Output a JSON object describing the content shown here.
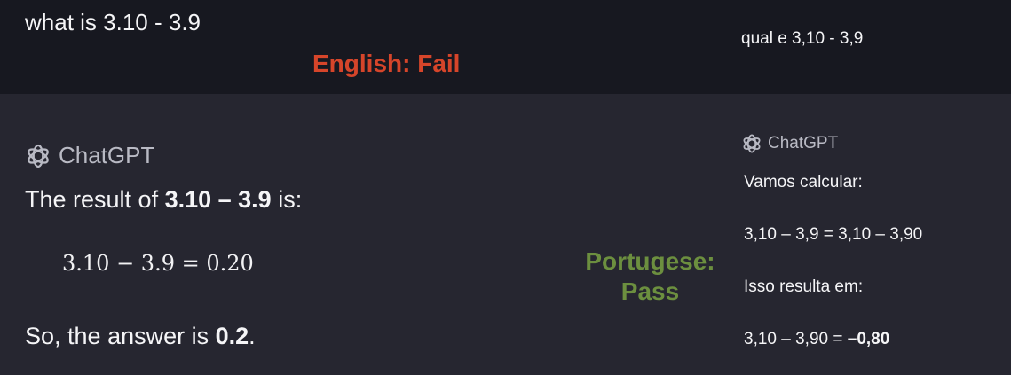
{
  "english": {
    "question": "what is 3.10 - 3.9",
    "label": "English: Fail",
    "brand": "ChatGPT",
    "result_prefix": "The result of ",
    "result_expr": "3.10 – 3.9",
    "result_suffix": " is:",
    "equation": "3.10 − 3.9 = 0.20",
    "answer_prefix": "So, the answer is ",
    "answer_value": "0.2",
    "answer_suffix": "."
  },
  "portuguese": {
    "question": "qual e 3,10 - 3,9",
    "label_line1": "Portugese:",
    "label_line2": "Pass",
    "brand": "ChatGPT",
    "calc_intro": "Vamos calcular:",
    "equation1": "3,10 – 3,9 = 3,10 – 3,90",
    "result_intro": "Isso resulta em:",
    "equation2_prefix": "3,10 – 3,90 = ",
    "equation2_value": "–0,80"
  },
  "colors": {
    "fail": "#d6452a",
    "pass": "#6c8f3f",
    "top_band": "#171820",
    "background": "#262630"
  },
  "icons": {
    "brand_logo": "openai-logo-icon"
  }
}
